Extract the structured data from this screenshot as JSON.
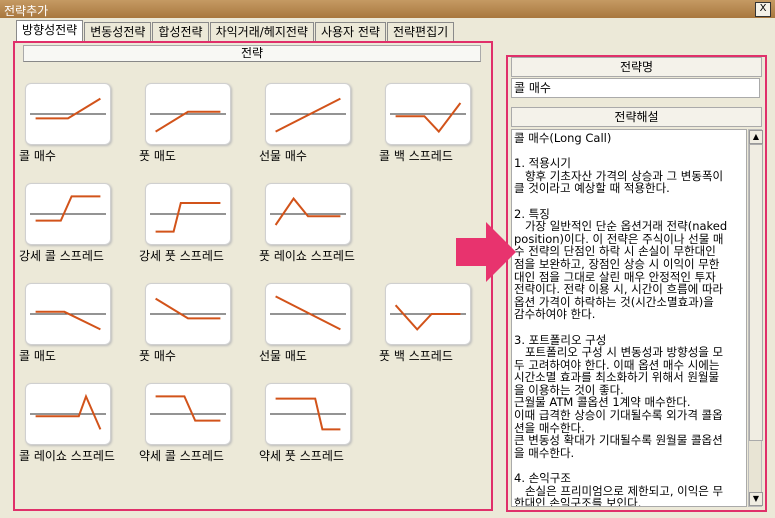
{
  "window": {
    "title": "전략추가",
    "close_label": "X"
  },
  "tabs": [
    "방향성전략",
    "변동성전략",
    "합성전략",
    "차익거래/헤지전략",
    "사용자 전략",
    "전략편집기"
  ],
  "active_tab": 0,
  "strategy_list": {
    "header": "전략",
    "items": [
      {
        "label": "콜 매수",
        "shape": "long-call"
      },
      {
        "label": "풋 매도",
        "shape": "short-put"
      },
      {
        "label": "선물 매수",
        "shape": "long-future"
      },
      {
        "label": "콜 백 스프레드",
        "shape": "call-back-spread"
      },
      {
        "label": "강세 콜 스프레드",
        "shape": "bull-call-spread"
      },
      {
        "label": "강세 풋 스프레드",
        "shape": "bull-put-spread"
      },
      {
        "label": "풋 레이쇼 스프레드",
        "shape": "put-ratio-spread"
      },
      {
        "label": "콜 매도",
        "shape": "short-call"
      },
      {
        "label": "풋 매수",
        "shape": "long-put"
      },
      {
        "label": "선물 매도",
        "shape": "short-future"
      },
      {
        "label": "풋 백 스프레드",
        "shape": "put-back-spread"
      },
      {
        "label": "콜 레이쇼 스프레드",
        "shape": "call-ratio-spread"
      },
      {
        "label": "약세 콜 스프레드",
        "shape": "bear-call-spread"
      },
      {
        "label": "약세 풋 스프레드",
        "shape": "bear-put-spread"
      }
    ]
  },
  "detail": {
    "name_header": "전략명",
    "name_value": "콜 매수",
    "desc_header": "전략해설",
    "description": "콜 매수(Long Call)\n\n1. 적용시기\n   향후 기초자산 가격의 상승과 그 변동폭이\n클 것이라고 예상할 때 적용한다.\n\n2. 특징\n   가장 일반적인 단순 옵션거래 전략(naked\nposition)이다. 이 전략은 주식이나 선물 매\n수 전략의 단점인 하락 시 손실이 무한대인\n점을 보완하고, 장점인 상승 시 이익이 무한\n대인 점을 그대로 살린 매우 안정적인 투자\n전략이다. 전략 이용 시, 시간이 흐름에 따라\n옵션 가격이 하락하는 것(시간소멸효과)을\n감수하여야 한다.\n\n3. 포트폴리오 구성\n   포트폴리오 구성 시 변동성과 방향성을 모\n두 고려하여야 한다. 이때 옵션 매수 시에는\n시간소멸 효과를 최소화하기 위해서 원월물\n을 이용하는 것이 좋다.\n근월물 ATM 콜옵션 1계약 매수한다.\n이때 급격한 상승이 기대될수록 외가격 콜옵\n션을 매수한다.\n큰 변동성 확대가 기대될수록 원월물 콜옵션\n을 매수한다.\n\n4. 손익구조\n   손실은 프리미엄으로 제한되고, 이익은 무\n한대인 손익구조를 보인다.\nBEP Point: 콜 옵션 가격에  매수프리미엄을 ",
    "scroll_up": "▲",
    "scroll_down": "▼"
  },
  "colors": {
    "accent_border": "#e0306a",
    "arrow": "#e8336e",
    "payoff": "#d2531a",
    "axis": "#555555"
  }
}
